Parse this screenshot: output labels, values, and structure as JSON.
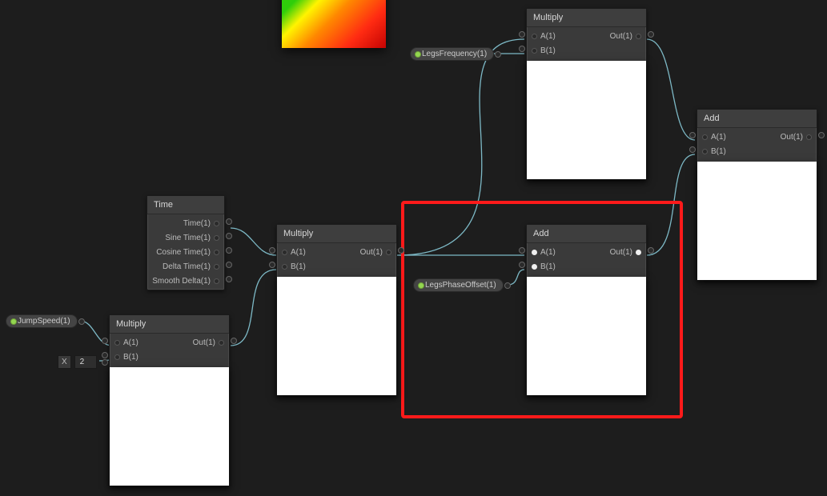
{
  "nodes": {
    "time": {
      "title": "Time",
      "outputs": [
        "Time(1)",
        "Sine Time(1)",
        "Cosine Time(1)",
        "Delta Time(1)",
        "Smooth Delta(1)"
      ]
    },
    "multiply1": {
      "title": "Multiply",
      "inA": "A(1)",
      "inB": "B(1)",
      "out": "Out(1)"
    },
    "multiply2": {
      "title": "Multiply",
      "inA": "A(1)",
      "inB": "B(1)",
      "out": "Out(1)"
    },
    "multiply3": {
      "title": "Multiply",
      "inA": "A(1)",
      "inB": "B(1)",
      "out": "Out(1)"
    },
    "add1": {
      "title": "Add",
      "inA": "A(1)",
      "inB": "B(1)",
      "out": "Out(1)"
    },
    "add2": {
      "title": "Add",
      "inA": "A(1)",
      "inB": "B(1)",
      "out": "Out(1)"
    }
  },
  "properties": {
    "jumpSpeed": "JumpSpeed(1)",
    "legsFrequency": "LegsFrequency(1)",
    "legsPhaseOffset": "LegsPhaseOffset(1)"
  },
  "constant": {
    "label": "X",
    "value": "2"
  }
}
